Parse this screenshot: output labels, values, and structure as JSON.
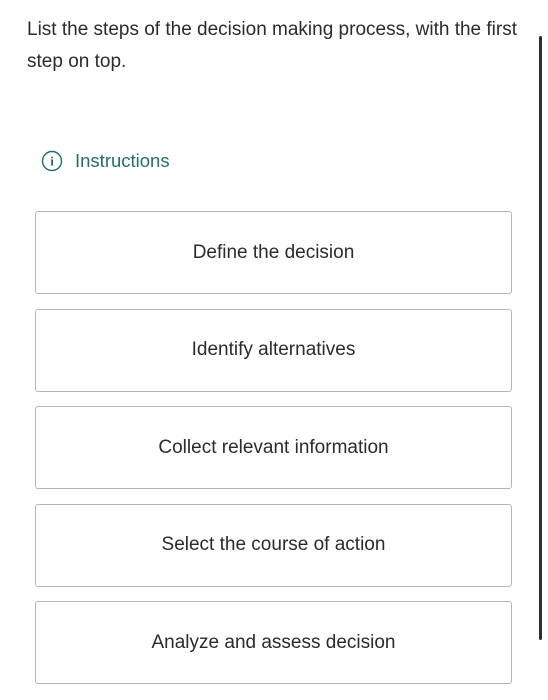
{
  "question": {
    "text": "List the steps of the decision making process, with the first step on top."
  },
  "instructions": {
    "icon": "info-icon",
    "label": "Instructions",
    "color": "#1f6e73"
  },
  "steps": [
    {
      "label": "Define the decision"
    },
    {
      "label": "Identify alternatives"
    },
    {
      "label": "Collect relevant information"
    },
    {
      "label": "Select the course of action"
    },
    {
      "label": "Analyze and assess decision"
    }
  ]
}
